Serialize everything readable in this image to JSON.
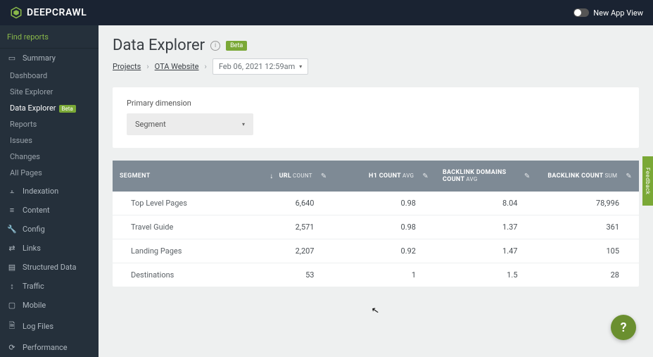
{
  "brand": "DEEPCRAWL",
  "new_app_view": "New App View",
  "sidebar": {
    "search_placeholder": "Find reports",
    "summary_label": "Summary",
    "subs": [
      {
        "label": "Dashboard"
      },
      {
        "label": "Site Explorer"
      },
      {
        "label": "Data Explorer",
        "active": true,
        "badge": "Beta"
      },
      {
        "label": "Reports"
      },
      {
        "label": "Issues"
      },
      {
        "label": "Changes"
      },
      {
        "label": "All Pages"
      }
    ],
    "sections": [
      {
        "icon": "⫠",
        "label": "Indexation"
      },
      {
        "icon": "≡",
        "label": "Content"
      },
      {
        "icon": "🔧",
        "label": "Config"
      },
      {
        "icon": "⇄",
        "label": "Links"
      },
      {
        "icon": "▤",
        "label": "Structured Data"
      },
      {
        "icon": "↕",
        "label": "Traffic"
      },
      {
        "icon": "▢",
        "label": "Mobile"
      },
      {
        "icon": "🗎",
        "label": "Log Files"
      },
      {
        "icon": "⟳",
        "label": "Performance"
      }
    ]
  },
  "page": {
    "title": "Data Explorer",
    "beta": "Beta",
    "breadcrumbs": {
      "projects": "Projects",
      "site": "OTA Website",
      "date": "Feb 06, 2021 12:59am"
    },
    "primary_dimension_label": "Primary dimension",
    "dimension_value": "Segment"
  },
  "table": {
    "headers": {
      "segment": "SEGMENT",
      "url": {
        "main": "URL",
        "sub": "COUNT"
      },
      "h1": {
        "main": "H1 COUNT",
        "sub": "AVG"
      },
      "backlink_domains": {
        "main": "BACKLINK DOMAINS COUNT",
        "sub": "AVG"
      },
      "backlink_count": {
        "main": "BACKLINK COUNT",
        "sub": "SUM"
      }
    },
    "rows": [
      {
        "segment": "Top Level Pages",
        "url": "6,640",
        "h1": "0.98",
        "bd": "8.04",
        "bc": "78,996"
      },
      {
        "segment": "Travel Guide",
        "url": "2,571",
        "h1": "0.98",
        "bd": "1.37",
        "bc": "361"
      },
      {
        "segment": "Landing Pages",
        "url": "2,207",
        "h1": "0.92",
        "bd": "1.47",
        "bc": "105"
      },
      {
        "segment": "Destinations",
        "url": "53",
        "h1": "1",
        "bd": "1.5",
        "bc": "28"
      }
    ]
  },
  "fab": "?",
  "feedback": "Feedback"
}
